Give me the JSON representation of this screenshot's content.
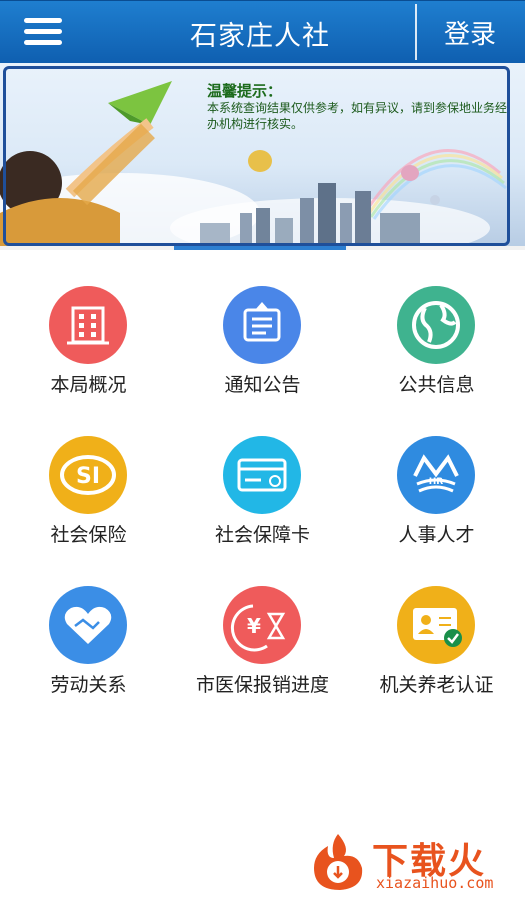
{
  "header": {
    "title": "石家庄人社",
    "login_label": "登录",
    "menu_icon": "hamburger-menu-icon"
  },
  "banner": {
    "notice_title": "温馨提示：",
    "notice_text": "本系统查询结果仅供参考，如有异议，请到参保地业务经办机构进行核实。"
  },
  "grid": [
    {
      "label": "本局概况",
      "icon": "building-icon",
      "color": "#ef5b5b"
    },
    {
      "label": "通知公告",
      "icon": "notice-board-icon",
      "color": "#4a86e8"
    },
    {
      "label": "公共信息",
      "icon": "globe-icon",
      "color": "#3fb38f"
    },
    {
      "label": "社会保险",
      "icon": "si-logo-icon",
      "color": "#f0b019"
    },
    {
      "label": "社会保障卡",
      "icon": "card-icon",
      "color": "#22b7e6"
    },
    {
      "label": "人事人才",
      "icon": "hr-logo-icon",
      "color": "#2f8be0"
    },
    {
      "label": "劳动关系",
      "icon": "handshake-heart-icon",
      "color": "#3b8ee6"
    },
    {
      "label": "市医保报销进度",
      "icon": "yuan-hourglass-icon",
      "color": "#ef5b5b"
    },
    {
      "label": "机关养老认证",
      "icon": "id-verify-icon",
      "color": "#f0b019"
    }
  ],
  "watermark": {
    "text": "下载火",
    "sub": "xiazaihuo.com"
  }
}
